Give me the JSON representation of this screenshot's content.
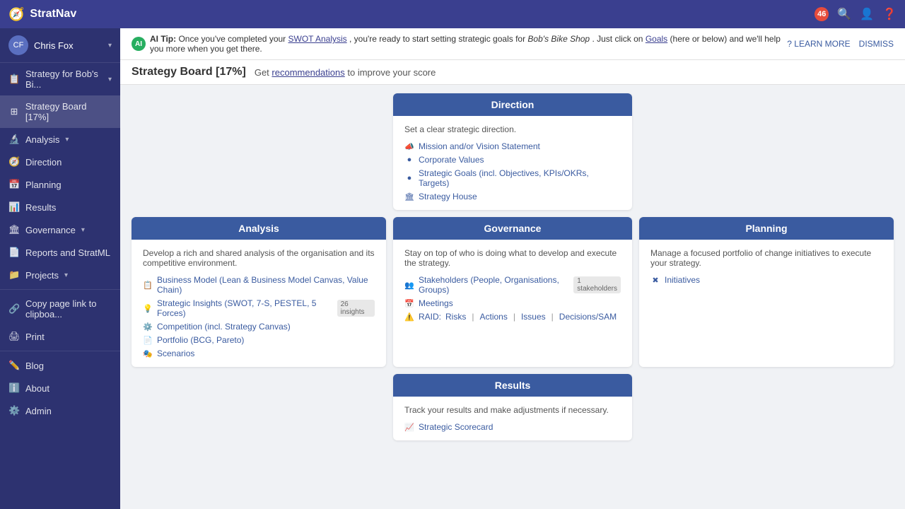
{
  "app": {
    "name": "StratNav",
    "logo_icon": "🧭"
  },
  "navbar": {
    "badge_count": "46",
    "search_icon": "🔍",
    "user_icon": "👤",
    "help_icon": "❓"
  },
  "sidebar": {
    "user": {
      "name": "Chris Fox",
      "initials": "CF",
      "chevron": "▾"
    },
    "items": [
      {
        "id": "strategy",
        "label": "Strategy for Bob's Bi...",
        "icon": "📋",
        "chevron": "▾",
        "active": false
      },
      {
        "id": "strategy-board",
        "label": "Strategy Board [17%]",
        "icon": "⊞",
        "active": true
      },
      {
        "id": "analysis",
        "label": "Analysis",
        "icon": "🔬",
        "chevron": "▾",
        "active": false
      },
      {
        "id": "direction",
        "label": "Direction",
        "icon": "🧭",
        "active": false
      },
      {
        "id": "planning",
        "label": "Planning",
        "icon": "📅",
        "active": false
      },
      {
        "id": "results",
        "label": "Results",
        "icon": "📊",
        "active": false
      },
      {
        "id": "governance",
        "label": "Governance",
        "icon": "🏛",
        "chevron": "▾",
        "active": false
      },
      {
        "id": "reports",
        "label": "Reports and StratML",
        "icon": "📄",
        "active": false
      },
      {
        "id": "projects",
        "label": "Projects",
        "icon": "📁",
        "chevron": "▾",
        "active": false
      },
      {
        "id": "copy-link",
        "label": "Copy page link to clipboa...",
        "icon": "🔗",
        "active": false
      },
      {
        "id": "print",
        "label": "Print",
        "icon": "🖨",
        "active": false
      },
      {
        "id": "blog",
        "label": "Blog",
        "icon": "✏️",
        "active": false
      },
      {
        "id": "about",
        "label": "About",
        "icon": "ℹ️",
        "active": false
      },
      {
        "id": "admin",
        "label": "Admin",
        "icon": "⚙️",
        "active": false
      }
    ]
  },
  "ai_tip": {
    "label": "AI Tip:",
    "text_before": "Once you've completed your",
    "swot_link": "SWOT Analysis",
    "text_middle": ", you're ready to start setting strategic goals for",
    "company_name": "Bob's Bike Shop",
    "text_after": ". Just click on",
    "goals_link": "Goals",
    "text_end": "(here or below) and we'll help you more when you get there.",
    "learn_more": "? LEARN MORE",
    "dismiss": "DISMISS"
  },
  "page_header": {
    "title": "Strategy Board [17%]",
    "score_text": "Get",
    "recommendations_link": "recommendations",
    "score_suffix": "to improve your score"
  },
  "direction_card": {
    "header": "Direction",
    "subtitle": "Set a clear strategic direction.",
    "links": [
      {
        "icon": "📣",
        "text": "Mission and/or Vision Statement"
      },
      {
        "icon": "●",
        "text": "Corporate Values"
      },
      {
        "icon": "●",
        "text": "Strategic Goals (incl. Objectives, KPIs/OKRs, Targets)"
      },
      {
        "icon": "🏛",
        "text": "Strategy House"
      }
    ]
  },
  "analysis_card": {
    "header": "Analysis",
    "subtitle": "Develop a rich and shared analysis of the organisation and its competitive environment.",
    "links": [
      {
        "icon": "📋",
        "text": "Business Model (Lean & Business Model Canvas, Value Chain)"
      },
      {
        "icon": "💡",
        "text": "Strategic Insights (SWOT, 7-S, PESTEL, 5 Forces)",
        "badge": "26 insights"
      },
      {
        "icon": "⚙️",
        "text": "Competition (incl. Strategy Canvas)"
      },
      {
        "icon": "📄",
        "text": "Portfolio (BCG, Pareto)"
      },
      {
        "icon": "🎭",
        "text": "Scenarios"
      }
    ]
  },
  "governance_card": {
    "header": "Governance",
    "subtitle": "Stay on top of who is doing what to develop and execute the strategy.",
    "links": [
      {
        "icon": "👥",
        "text": "Stakeholders (People, Organisations, Groups)",
        "badge": "1 stakeholders"
      },
      {
        "icon": "📅",
        "text": "Meetings"
      },
      {
        "icon": "⚠️",
        "text": "RAID: ",
        "raid_parts": [
          "Risks",
          "Actions",
          "Issues",
          "Decisions/SAM"
        ]
      }
    ]
  },
  "planning_card": {
    "header": "Planning",
    "subtitle": "Manage a focused portfolio of change initiatives to execute your strategy.",
    "links": [
      {
        "icon": "✖",
        "text": "Initiatives"
      }
    ]
  },
  "results_card": {
    "header": "Results",
    "subtitle": "Track your results and make adjustments if necessary.",
    "links": [
      {
        "icon": "📈",
        "text": "Strategic Scorecard"
      }
    ]
  }
}
